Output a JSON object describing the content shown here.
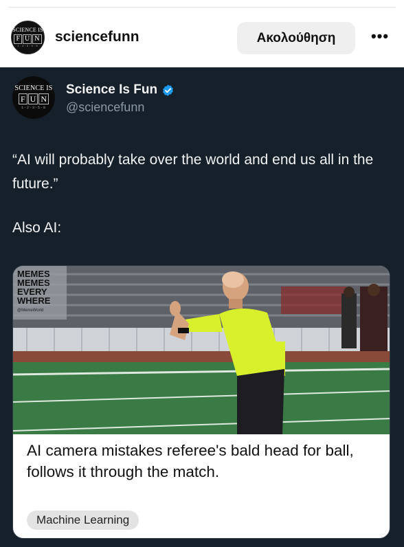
{
  "header": {
    "avatar_logo": {
      "top": "SCIENCE IS",
      "letters": [
        "F",
        "U",
        "N"
      ],
      "numbers": "1·2·3·5·8"
    },
    "username": "sciencefunn",
    "follow_label": "Ακολούθηση",
    "more_icon": "more-dots-icon"
  },
  "post": {
    "author": {
      "display_name": "Science Is Fun",
      "handle": "@sciencefunn",
      "verified_icon": "verified-badge-icon",
      "avatar_logo": {
        "top": "SCIENCE IS",
        "letters": [
          "F",
          "U",
          "N"
        ],
        "numbers": "1·2·3·5·8"
      }
    },
    "text": "“AI will probably take over the world and end us all in the future.”",
    "text2": "Also AI:",
    "card": {
      "watermark": {
        "lines": [
          "MEMES",
          "MEMES",
          "EVERY",
          "WHERE"
        ],
        "sub": "@MemeWorld"
      },
      "title": "AI camera mistakes referee's bald head for ball, follows it through the match.",
      "tag": "Machine Learning"
    }
  },
  "colors": {
    "post_bg": "#15202b",
    "verified": "#1d9bf0",
    "follow_bg": "#efefef"
  }
}
